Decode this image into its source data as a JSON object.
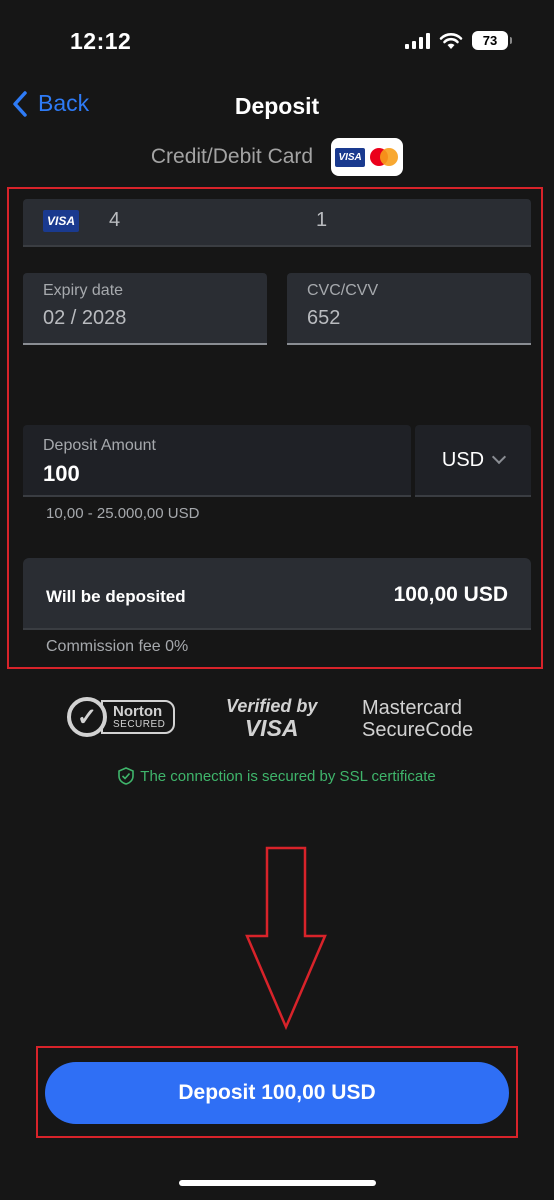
{
  "status_bar": {
    "time": "12:12",
    "battery": "73"
  },
  "nav": {
    "back_label": "Back",
    "title": "Deposit"
  },
  "method": {
    "label": "Credit/Debit Card",
    "visa_text": "VISA"
  },
  "card_field": {
    "visa_text": "VISA",
    "number_start": "4",
    "number_end": "1"
  },
  "expiry": {
    "label": "Expiry date",
    "value": "02 / 2028"
  },
  "cvc": {
    "label": "CVC/CVV",
    "value": "652"
  },
  "deposit_amount": {
    "label": "Deposit Amount",
    "value": "100",
    "currency": "USD",
    "range_hint": "10,00 - 25.000,00 USD"
  },
  "summary": {
    "label": "Will be deposited",
    "value": "100,00 USD",
    "commission": "Commission fee 0%"
  },
  "trust": {
    "norton_line1": "Norton",
    "norton_line2": "SECURED",
    "vbv_line1": "Verified by",
    "vbv_line2": "VISA",
    "mc_line1": "Mastercard",
    "mc_line2": "SecureCode",
    "ssl_text": "The connection is secured by SSL certificate"
  },
  "deposit_button": {
    "label": "Deposit 100,00 USD"
  },
  "colors": {
    "accent": "#2f6ff5",
    "link": "#2e7bf6",
    "success": "#3fb56b",
    "annotation": "#d8232a",
    "background": "#161616"
  }
}
